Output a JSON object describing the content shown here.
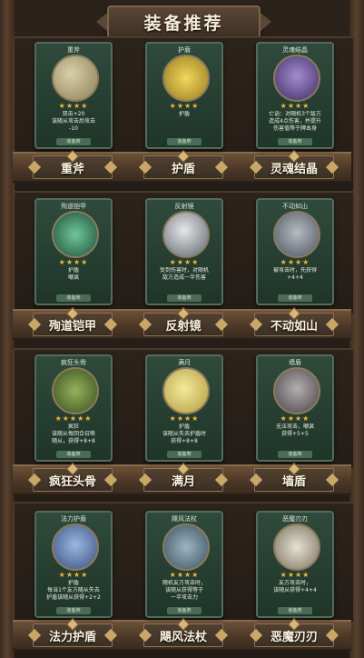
{
  "title": "装备推荐",
  "rows": [
    {
      "items": [
        {
          "card_name": "重斧",
          "label": "重斧",
          "stars": "★★★★",
          "desc": "双击+20\n该随从攻击后攻击\n-10",
          "type_tag": "装备牌",
          "icon": "axe-icon"
        },
        {
          "card_name": "护盾",
          "label": "护盾",
          "stars": "★★★★",
          "desc": "护盾",
          "type_tag": "装备牌",
          "icon": "shield-icon"
        },
        {
          "card_name": "灵魂结晶",
          "label": "灵魂结晶",
          "stars": "★★★★",
          "desc": "亡语：对随机3个敌方\n造成4点伤害，并提升\n伤害值等于牌本身",
          "type_tag": "装备牌",
          "icon": "crystal-icon"
        }
      ]
    },
    {
      "items": [
        {
          "card_name": "殉道铠甲",
          "label": "殉道铠甲",
          "stars": "★★★★",
          "desc": "护盾\n嘲讽",
          "type_tag": "装备牌",
          "icon": "armor-icon"
        },
        {
          "card_name": "反射镜",
          "label": "反射镜",
          "stars": "★★★★",
          "desc": "受到伤害时，对随机\n敌方造成一半伤害",
          "type_tag": "装备牌",
          "icon": "mirror-icon"
        },
        {
          "card_name": "不动如山",
          "label": "不动如山",
          "stars": "★★★★",
          "desc": "被攻击时，先获得\n+4+4",
          "type_tag": "装备牌",
          "icon": "helmet-icon"
        }
      ]
    },
    {
      "items": [
        {
          "card_name": "疯狂头骨",
          "label": "疯狂头骨",
          "stars": "★★★★★",
          "desc": "疯狂\n该随从每回合召唤\n随从，获得+8+8",
          "type_tag": "装备牌",
          "icon": "skull-icon"
        },
        {
          "card_name": "满月",
          "label": "满月",
          "stars": "★★★★",
          "desc": "护盾\n该随从失去护盾时\n获得+8+8",
          "type_tag": "装备牌",
          "icon": "moon-icon"
        },
        {
          "card_name": "墙盾",
          "label": "墙盾",
          "stars": "★★★★",
          "desc": "无法攻击，嘲讽\n获得+5+5",
          "type_tag": "装备牌",
          "icon": "wall-shield-icon"
        }
      ]
    },
    {
      "items": [
        {
          "card_name": "法力护盾",
          "label": "法力护盾",
          "stars": "★★★★",
          "desc": "护盾\n每当1个友方随从失去\n护盾该随从获得+2+2",
          "type_tag": "装备牌",
          "icon": "mana-shield-icon"
        },
        {
          "card_name": "飓风法杖",
          "label": "飓风法杖",
          "stars": "★★★★",
          "desc": "随机友方攻击时，\n该随从获得等于\n一半攻击力",
          "type_tag": "装备牌",
          "icon": "staff-icon"
        },
        {
          "card_name": "恶魔刃刃",
          "label": "恶魔刃刃",
          "stars": "★★★★",
          "desc": "友方攻击时，\n该随从获得+4+4",
          "type_tag": "装备牌",
          "icon": "blade-icon"
        }
      ]
    }
  ]
}
